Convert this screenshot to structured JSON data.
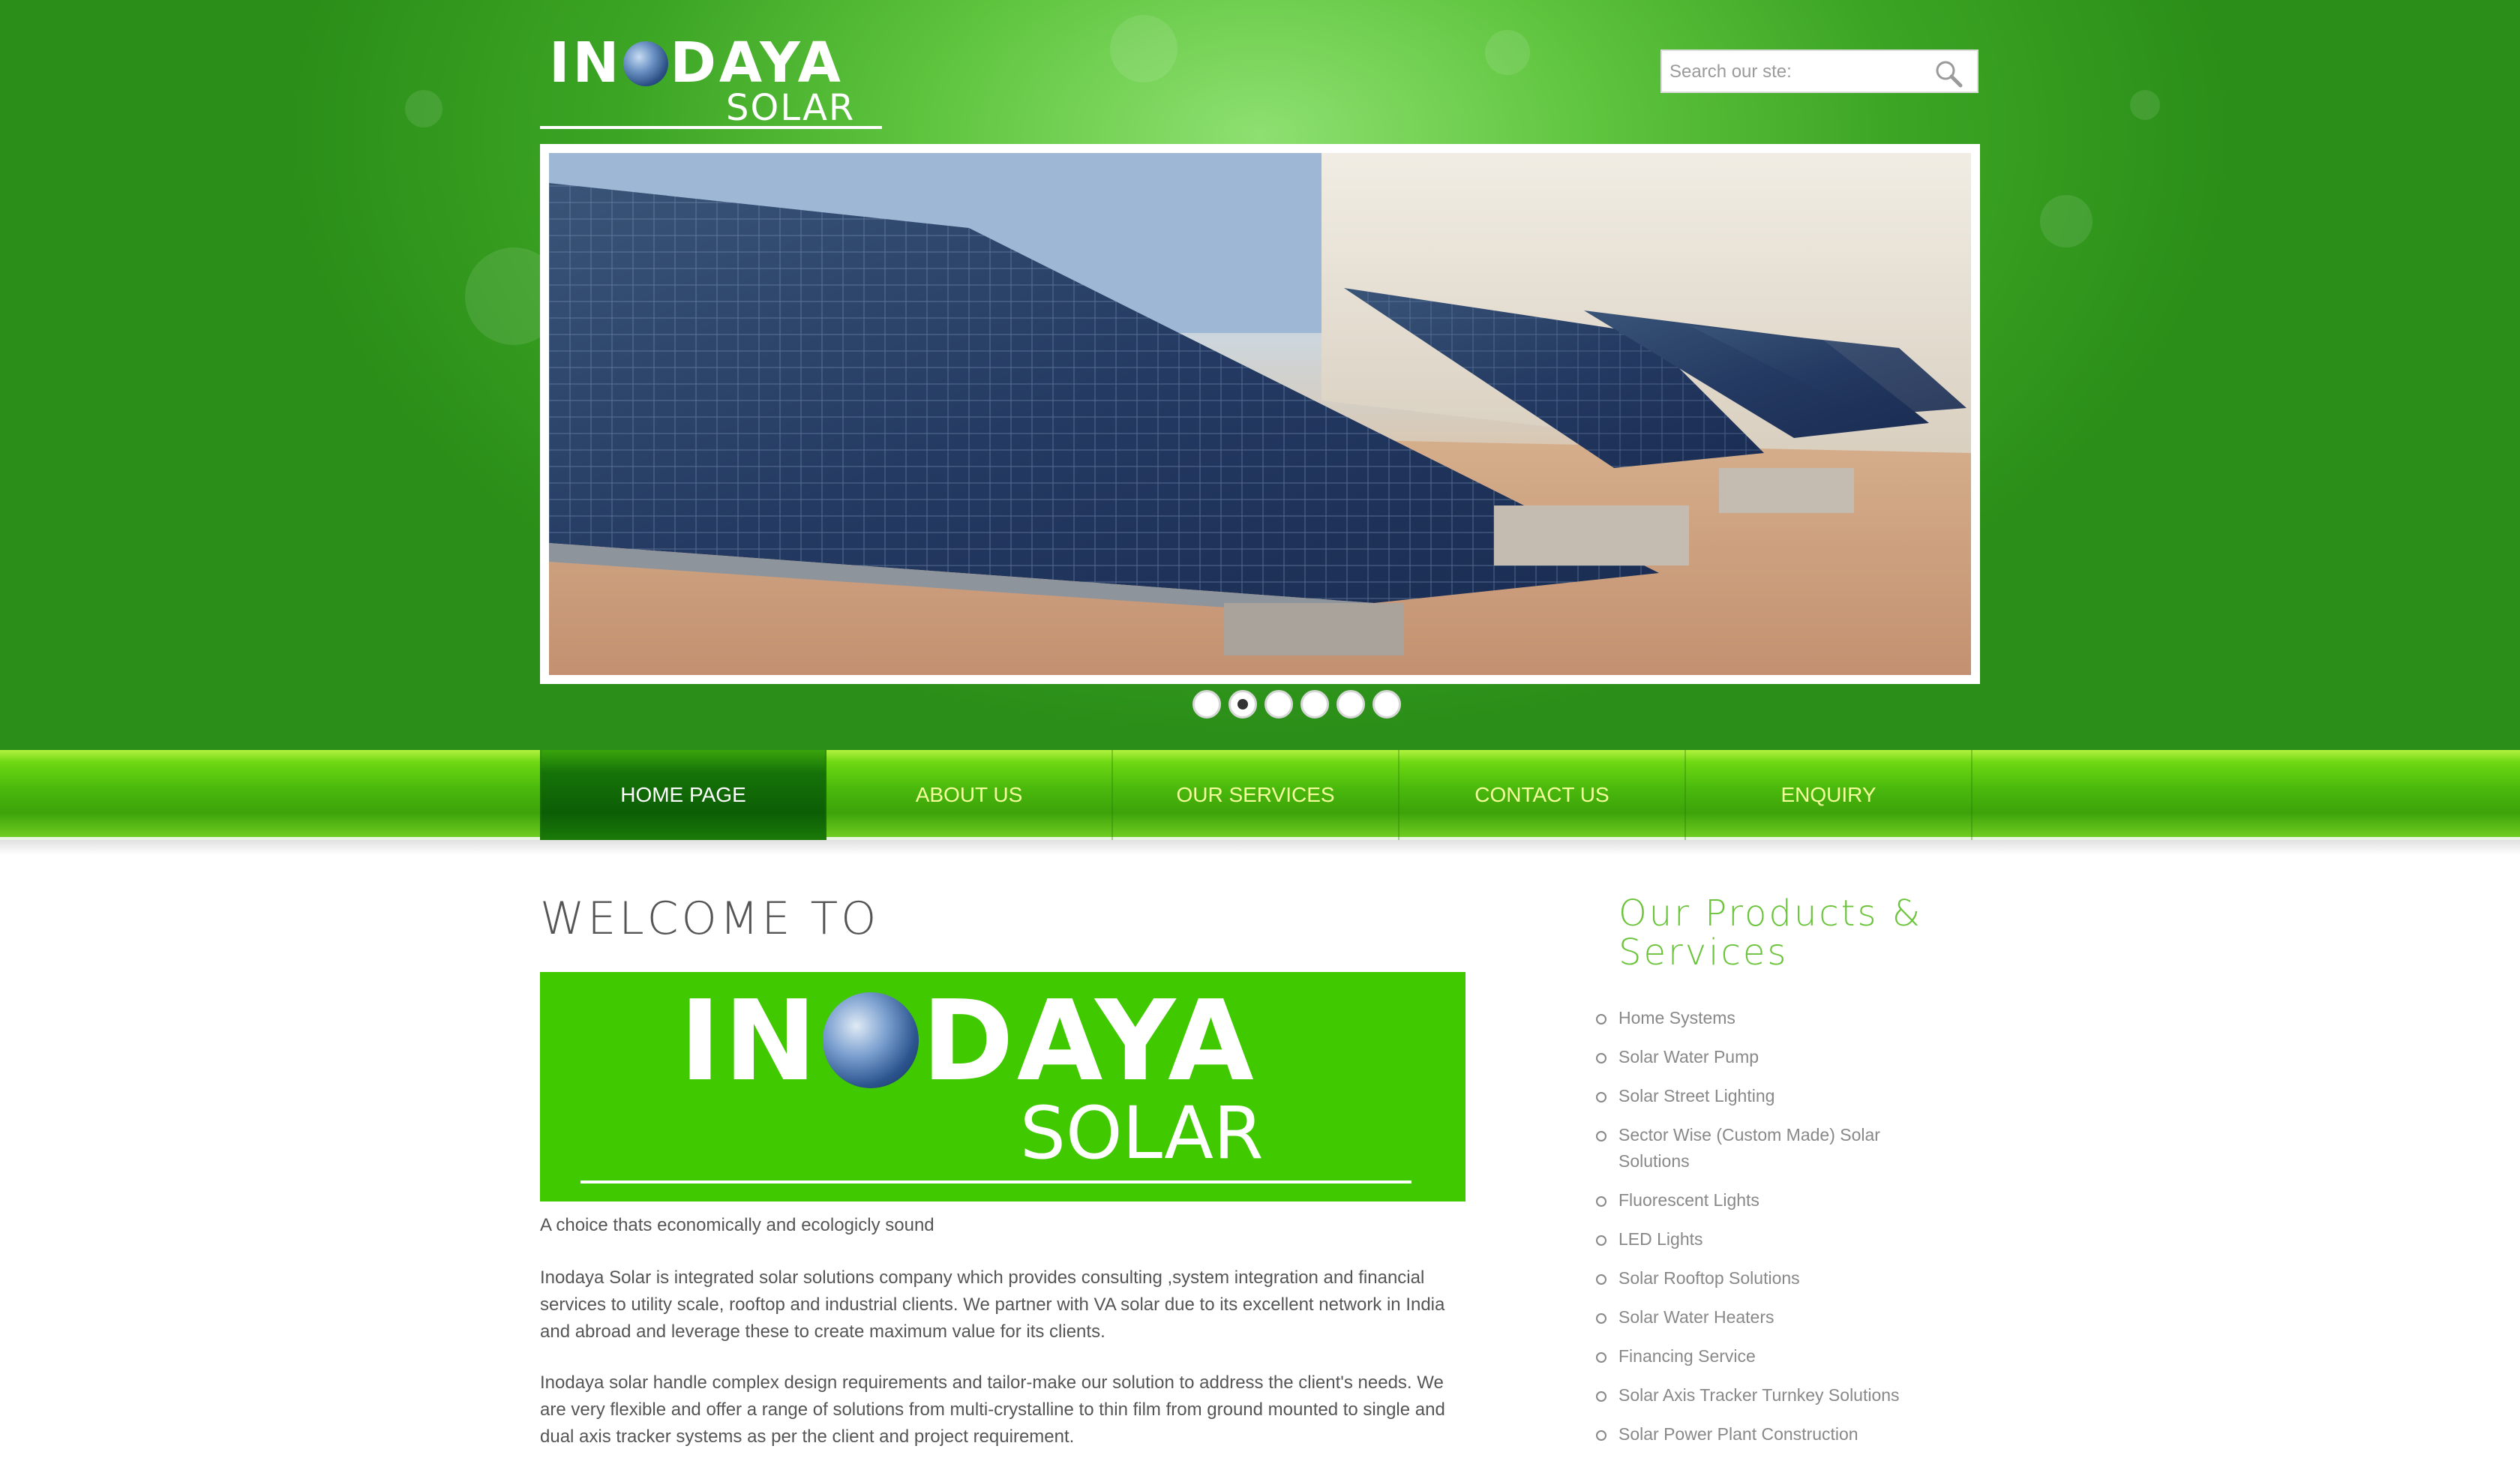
{
  "header": {
    "logo_top_left": "IN",
    "logo_top_right": "DAYA",
    "logo_bottom": "SOLAR",
    "search_placeholder": "Search our ste:"
  },
  "slider": {
    "dots": 6,
    "active_dot": 2
  },
  "nav": {
    "items": [
      {
        "label": "HOME PAGE",
        "active": true
      },
      {
        "label": "ABOUT US",
        "active": false
      },
      {
        "label": "OUR SERVICES",
        "active": false
      },
      {
        "label": "CONTACT US",
        "active": false
      },
      {
        "label": "ENQUIRY",
        "active": false
      }
    ]
  },
  "main": {
    "welcome": "WELCOME TO",
    "banner_top_left": "IN",
    "banner_top_right": "DAYA",
    "banner_bottom": "SOLAR",
    "tagline": "A choice thats economically and ecologicly sound",
    "para1": "Inodaya Solar is integrated solar solutions company which provides consulting ,system integration and financial services to utility scale, rooftop and industrial clients. We partner with VA solar due to its excellent network in India and abroad and leverage these to create maximum value for its clients.",
    "para2": "Inodaya solar handle complex design requirements and tailor-make our solution to address the client's needs. We are very flexible and offer a range of solutions from multi-crystalline to thin film from ground mounted to single and dual axis tracker systems as per the client and project requirement."
  },
  "sidebar": {
    "title": "Our Products & Services",
    "items": [
      "Home Systems",
      "Solar Water Pump",
      "Solar Street Lighting",
      "Sector Wise (Custom Made) Solar Solutions",
      "Fluorescent Lights",
      "LED Lights",
      "Solar Rooftop Solutions",
      "Solar Water Heaters",
      "Financing Service",
      "Solar Axis Tracker Turnkey Solutions",
      "Solar Power Plant Construction"
    ]
  },
  "colors": {
    "brand_green": "#41c900",
    "nav_text": "#f4ff9c",
    "sidebar_title": "#6bc43c"
  }
}
